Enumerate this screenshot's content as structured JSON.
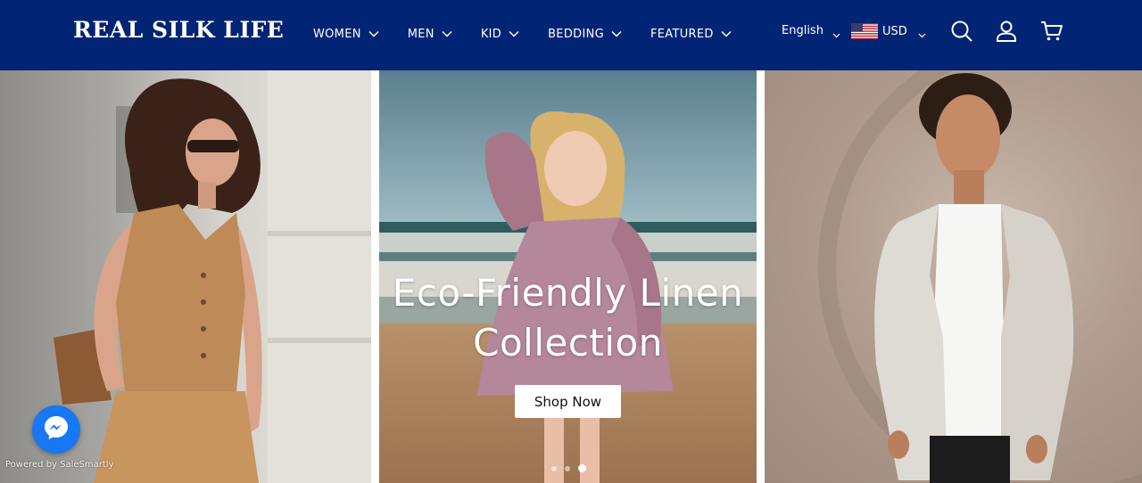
{
  "header": {
    "logo": "REAL SILK LIFE",
    "nav": [
      {
        "label": "WOMEN"
      },
      {
        "label": "MEN"
      },
      {
        "label": "KID"
      },
      {
        "label": "BEDDING"
      },
      {
        "label": "FEATURED"
      }
    ],
    "language": "English",
    "currency": "USD",
    "icons": {
      "search": "search-icon",
      "account": "user-icon",
      "cart": "cart-icon",
      "chevron": "chevron-down-icon",
      "flag": "us-flag-icon"
    },
    "colors": {
      "header_bg": "#022474",
      "text": "#ffffff"
    }
  },
  "hero": {
    "title_line1": "Eco-Friendly Linen",
    "title_line2": "Collection",
    "button_label": "Shop Now",
    "slide_count": 3,
    "active_slide": 3
  },
  "widgets": {
    "messenger_icon": "messenger-icon",
    "powered_by": "Powered by SaleSmartly",
    "messenger_color": "#1877f2"
  }
}
